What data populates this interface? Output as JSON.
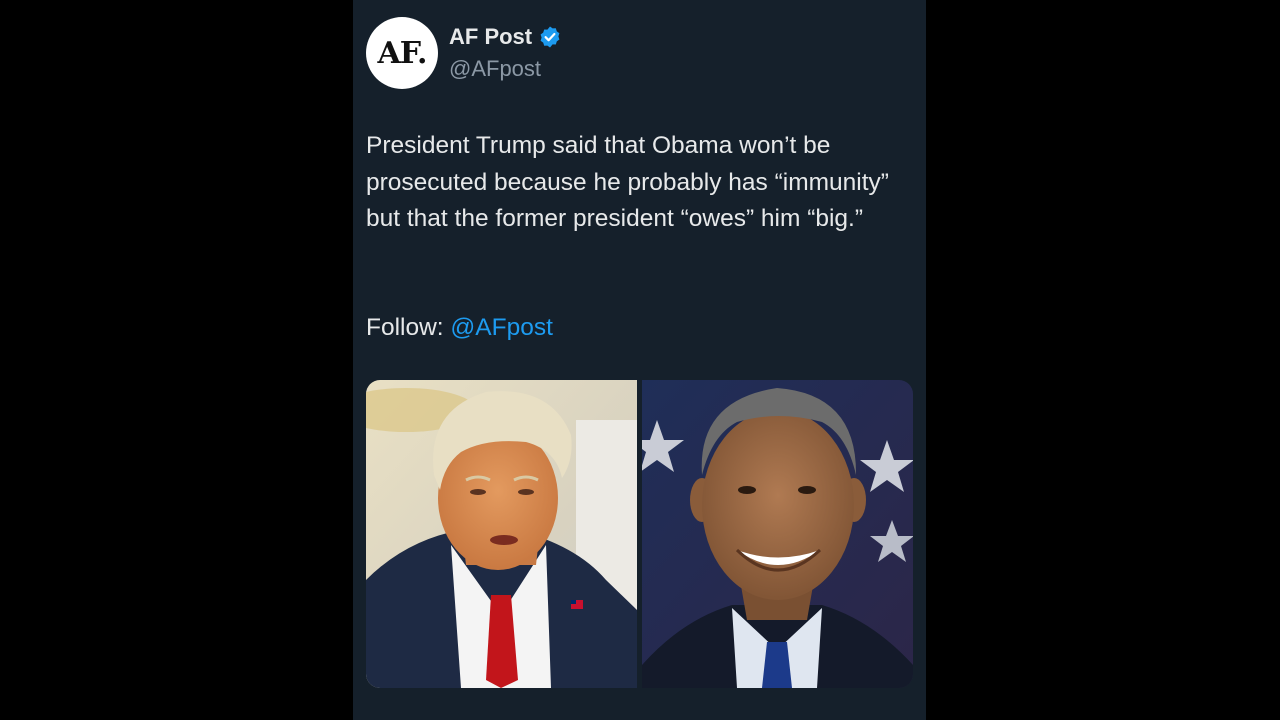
{
  "post": {
    "author": {
      "avatar_text": "AF.",
      "display_name": "AF Post",
      "handle": "@AFpost",
      "verified_icon": "verified-badge-icon"
    },
    "text": "President Trump said that Obama won’t be prosecuted because he probably has “immunity” but that the former president “owes” him “big.”",
    "follow_label": "Follow:",
    "follow_mention": "@AFpost",
    "media": [
      {
        "subject": "trump-photo"
      },
      {
        "subject": "obama-photo"
      }
    ]
  },
  "colors": {
    "page_background": "#000000",
    "card_background": "#15202b",
    "primary_text": "#e7e9ea",
    "secondary_text": "#8b98a5",
    "link_blue": "#1d9bf0",
    "verified_blue": "#1d9bf0"
  }
}
